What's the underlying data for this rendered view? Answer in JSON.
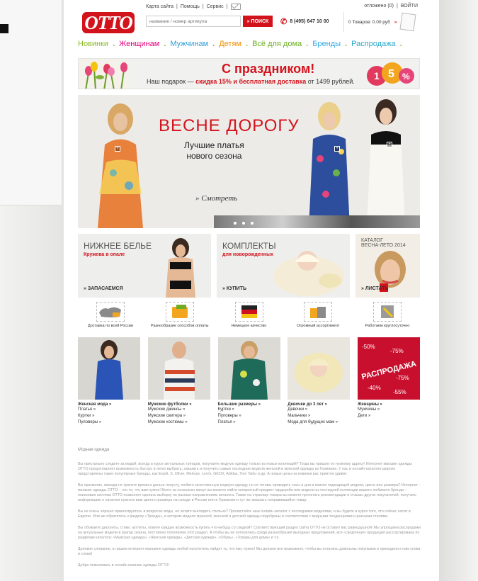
{
  "header": {
    "top_links": [
      "Карта сайта",
      "Помощь",
      "Сервис"
    ],
    "user_links": [
      "отложено (0)",
      "ВОЙТИ"
    ],
    "logo": "OTTO",
    "search_placeholder": "название / номер артикула",
    "search_button": "» ПОИСК",
    "phone": "8 (495) 647 10 00",
    "cart_text": "0 Товаров: 0.00 руб"
  },
  "nav": [
    {
      "label": "Новинки",
      "color": "#8bb92d"
    },
    {
      "label": "Женщинам",
      "color": "#e6007e"
    },
    {
      "label": "Мужчинам",
      "color": "#2d9fd8"
    },
    {
      "label": "Детям",
      "color": "#f28f00"
    },
    {
      "label": "Всё для дома",
      "color": "#6cad22"
    },
    {
      "label": "Бренды",
      "color": "#35a9e0"
    },
    {
      "label": "Распродажа",
      "color": "#2aa7c9"
    }
  ],
  "holiday_banner": {
    "title": "С праздником!",
    "text_before": "Наш подарок —",
    "text_highlight": "скидка 15% и бесплатная доставка",
    "text_after": "от 1499 рублей.",
    "ball_1": "1",
    "ball_2": "5",
    "ball_3": "%"
  },
  "hero": {
    "title": "ВЕСНЕ ДОРОГУ",
    "subtitle_1": "Лучшие платья",
    "subtitle_2": "нового сезона",
    "cta": "» Смотреть"
  },
  "promos": [
    {
      "title": "НИЖНЕЕ БЕЛЬЕ",
      "subtitle": "Кружева в опале",
      "cta": "» ЗАПАСАЕМСЯ"
    },
    {
      "title": "КОМПЛЕКТЫ",
      "subtitle": "для новорожденных",
      "cta": "» КУПИТЬ"
    },
    {
      "title": "КАТАЛОГ",
      "subtitle": "ВЕСНА-ЛЕТО 2014",
      "cta": "» ЛИСТАТЬ"
    }
  ],
  "features": [
    "Доставка по всей России",
    "Разнообразие способов оплаты",
    "Немецкое качество",
    "Огромный ассортимент",
    "Работаем круглосуточно"
  ],
  "categories": [
    {
      "title": "Женская мода »",
      "links": [
        "Платья »",
        "Куртки »",
        "Пуловеры »"
      ]
    },
    {
      "title": "Мужские футболки »",
      "links": [
        "Мужские джинсы »",
        "Мужские свитера »",
        "Мужские костюмы »"
      ]
    },
    {
      "title": "Большие размеры »",
      "links": [
        "Куртки »",
        "Пуловеры »",
        "Платья »"
      ]
    },
    {
      "title": "Девочки до 3 лет »",
      "links": [
        "Девочки »",
        "Мальчики »",
        "Мода для будущих мам »"
      ]
    },
    {
      "title": "Женщины »",
      "links": [
        "Мужчины »",
        "Дети »"
      ]
    }
  ],
  "sale_banner": {
    "label": "РАСПРОДАЖА",
    "p1": "-50%",
    "p2": "-75%",
    "p3": "-75%",
    "p4": "-40%",
    "p5": "-55%"
  },
  "seo": {
    "title": "Модная одежда",
    "paragraphs": [
      "Вы пристально следите за модой, всегда в курсе актуальных трендов, покупаете модную одежду только из новых коллекций? Тогда вы пришли по нужному адресу! Интернет магазин одежды OTTO предоставляет возможность быстро и легко выбрать, заказать и получить самые последние модели женской и мужской одежды из Германии. У нас в онлайн-каталоге широко представлены такие популярные бренды, как Esprit, S. Oliver, Melrose, Levi's, GEOX, Adidas, Tom Tailor и др. А новые цены на новинки вас приятно удивят.",
      "Вы прагматик, никогда не тратите время и деньги попусту, любите качественную модную одежду, но не готовы проводить часы и дни в поиске подходящей модели, цвета или размера? Интернет - магазин одежды OTTO – это то, что вам нужно! Всего за несколько минут вы можете найти конкретный предмет гардероба или модели из последней коллекции вашего любимого бренда – поисковая система OTTO позволяет сделать выборку по разным направлениям каталога. Также на странице товара вы можете прочитать рекомендации и отзывы других покупателей, получить информацию о наличии нужного вам цвета и размера на складе в России или в Германии и тут же заказать понравившийся товар.",
      "Вы не очень хорошо ориентируетесь в вопросах моды, но хотите выглядеть стильно? Пролистайте наш онлайн каталог с последними моделями, и вы будете в курсе того, что сейчас носят в Европе. Или же обратитесь к разделу «Тренды», в котором модели мужской, женской и детской одежды подобраны в соответствии с модными тенденциями и разными стилями.",
      "Вы обожаете дисконты, стоки, аутлеты, ловите каждую возможность купить что-нибудь со скидкой? Соответствующий раздел сайта OTTO не оставит вас равнодушной! Мы упрощаем распродажи на актуальные модели в разгар сезона, постоянно пополняем этот раздел. А чтобы вы не потерялись среди разнообразия выгодных предложений, все «сводочная» продукция рассортирована по разделам каталога: «Мужская одежда», «Женская одежда», «Детская одежда», «Обувь», «Товары для дома» и т.п.",
      "Деловое слование, в нашем интернет-магазине одежды любой посетитель найдет то, что ему нужно! Мы делаем все возможное, чтобы вы остались довольны покупками и приходили к нам снова и снова!",
      "Добро пожаловать в онлайн магазин одежды OTTO!"
    ]
  }
}
